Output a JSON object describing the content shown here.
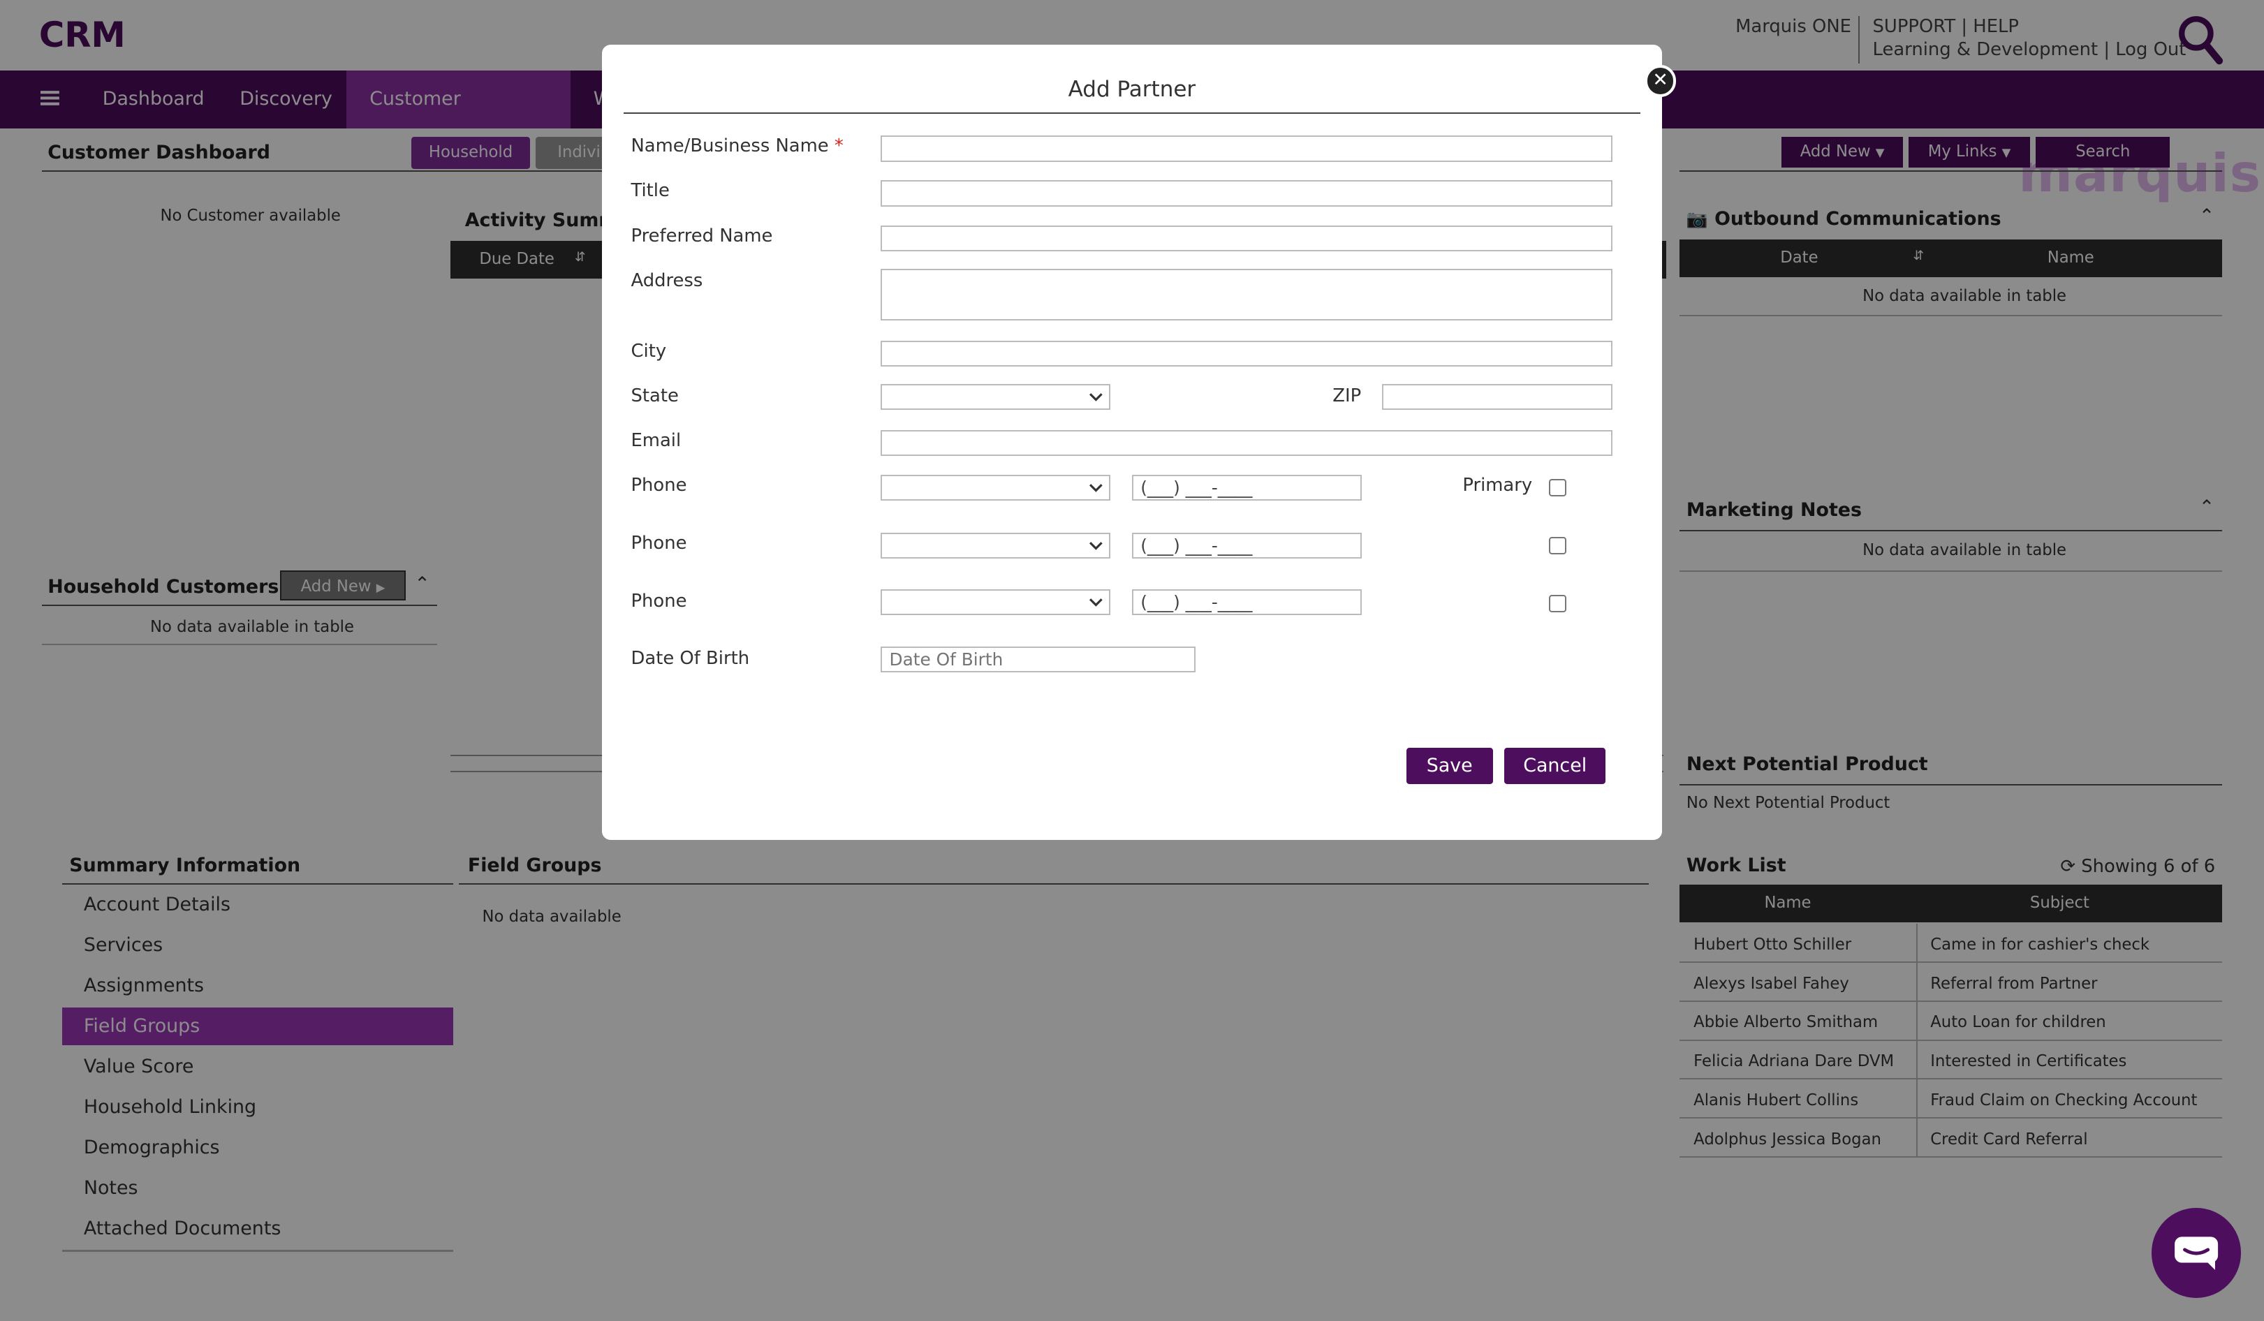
{
  "app": {
    "title": "CRM",
    "brand": "marquis",
    "top_links": {
      "product": "Marquis ONE",
      "support": "SUPPORT",
      "sep": "|",
      "help": "HELP",
      "learning": "Learning & Development",
      "logout": "Log Out"
    }
  },
  "nav": {
    "items": [
      "Dashboard",
      "Discovery",
      "Customer Dashboard",
      "W"
    ]
  },
  "page": {
    "title": "Customer Dashboard",
    "household_btn": "Household",
    "individual_btn": "Indivi",
    "add_new": "Add New",
    "my_links": "My Links",
    "search": "Search",
    "no_customer": "No Customer available"
  },
  "activity": {
    "title": "Activity Summ",
    "col_due": "Due Date"
  },
  "household_customers": {
    "title": "Household Customers",
    "add_new": "Add New",
    "empty": "No data available in table"
  },
  "summary": {
    "title": "Summary Information",
    "items": [
      "Account Details",
      "Services",
      "Assignments",
      "Field Groups",
      "Value Score",
      "Household Linking",
      "Demographics",
      "Notes",
      "Attached Documents"
    ],
    "active": "Field Groups"
  },
  "field_groups": {
    "title": "Field Groups",
    "empty": "No data available"
  },
  "outbound": {
    "title": "Outbound Communications",
    "col_date": "Date",
    "col_name": "Name",
    "empty": "No data available in table"
  },
  "marketing": {
    "title": "Marketing Notes",
    "empty": "No data available in table"
  },
  "next_product": {
    "title": "Next Potential Product",
    "empty": "No Next Potential Product"
  },
  "work_list": {
    "title": "Work List",
    "showing": "Showing 6 of 6",
    "col_name": "Name",
    "col_subject": "Subject",
    "rows": [
      {
        "name": "Hubert Otto Schiller",
        "subject": "Came in for cashier's check"
      },
      {
        "name": "Alexys Isabel Fahey",
        "subject": "Referral from Partner"
      },
      {
        "name": "Abbie Alberto Smitham",
        "subject": "Auto Loan for children"
      },
      {
        "name": "Felicia Adriana Dare DVM",
        "subject": "Interested in Certificates"
      },
      {
        "name": "Alanis Hubert Collins",
        "subject": "Fraud Claim on Checking Account"
      },
      {
        "name": "Adolphus Jessica Bogan",
        "subject": "Credit Card Referral"
      }
    ]
  },
  "modal": {
    "title": "Add Partner",
    "labels": {
      "name": "Name/Business Name",
      "req": "*",
      "title": "Title",
      "preferred": "Preferred Name",
      "address": "Address",
      "city": "City",
      "state": "State",
      "zip": "ZIP",
      "email": "Email",
      "phone": "Phone",
      "primary": "Primary",
      "dob": "Date Of Birth"
    },
    "phone_mask": "(___) ___-____",
    "dob_placeholder": "Date Of Birth",
    "save": "Save",
    "cancel": "Cancel"
  },
  "icons": {
    "close": "close-icon",
    "search": "search-icon",
    "menu": "hamburger-icon",
    "camera": "camera-icon",
    "refresh": "refresh-icon",
    "chat": "chat-icon"
  },
  "colors": {
    "brand": "#4e0e5e",
    "accent": "#8a2ea3"
  }
}
